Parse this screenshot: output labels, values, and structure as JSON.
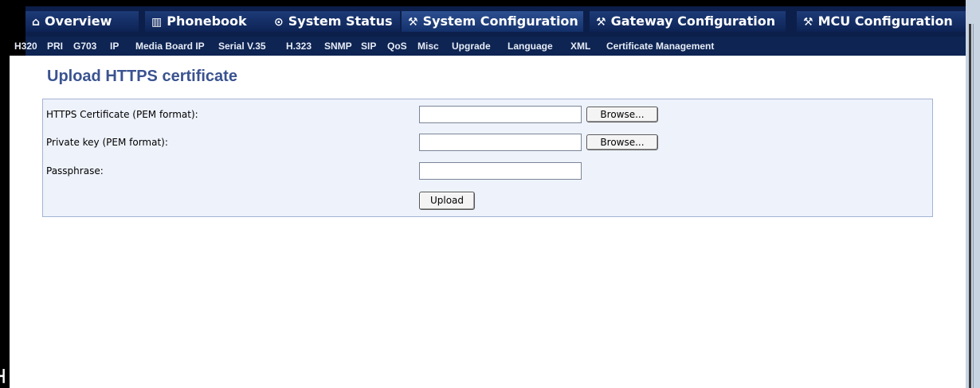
{
  "tabs": [
    {
      "label": "Overview",
      "icon": "home-icon",
      "glyph": "⌂"
    },
    {
      "label": "Phonebook",
      "icon": "phonebook-icon",
      "glyph": "▥"
    },
    {
      "label": "System Status",
      "icon": "status-icon",
      "glyph": "⊙"
    },
    {
      "label": "System Configuration",
      "icon": "wrench-icon",
      "glyph": "⚒"
    },
    {
      "label": "Gateway Configuration",
      "icon": "wrench-icon",
      "glyph": "⚒"
    },
    {
      "label": "MCU Configuration",
      "icon": "wrench-icon",
      "glyph": "⚒"
    }
  ],
  "subnav": [
    "H320",
    "PRI",
    "G703",
    "IP",
    "Media Board IP",
    "Serial V.35",
    "H.323",
    "SNMP",
    "SIP",
    "QoS",
    "Misc",
    "Upgrade",
    "Language",
    "XML",
    "Certificate Management"
  ],
  "page": {
    "title": "Upload HTTPS certificate",
    "cert_label": "HTTPS Certificate (PEM format):",
    "key_label": "Private key (PEM format):",
    "pass_label": "Passphrase:",
    "browse_label": "Browse...",
    "upload_label": "Upload",
    "cert_value": "",
    "key_value": "",
    "pass_value": ""
  },
  "colors": {
    "tab_bar": "#0c1f4a",
    "title": "#3a5390",
    "panel_bg": "#eef2fb",
    "panel_border": "#a4b3d2"
  }
}
